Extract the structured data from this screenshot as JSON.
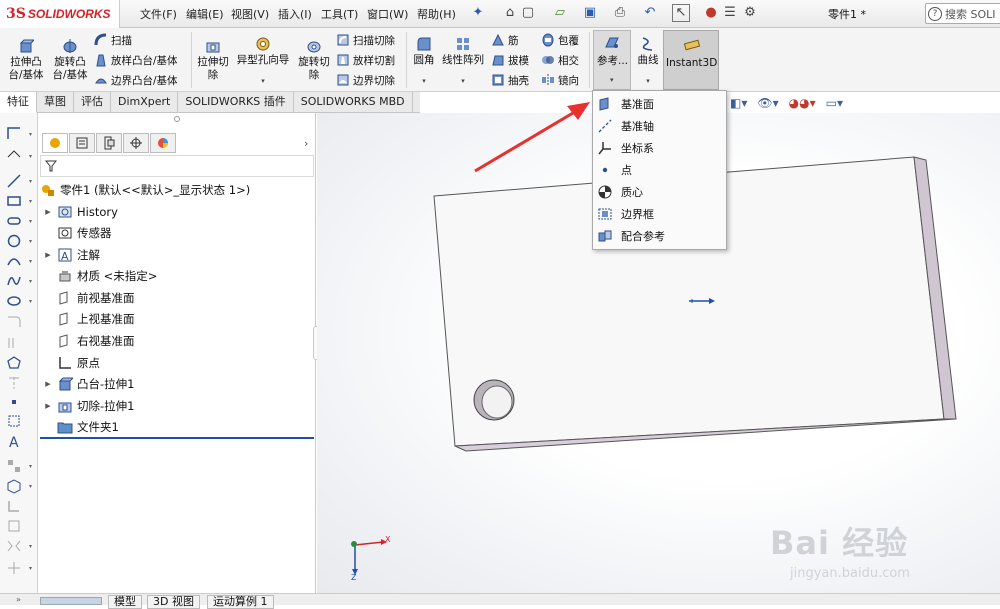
{
  "app": {
    "brand_ds": "3S",
    "brand_name": "SOLIDWORKS",
    "doc_title": "零件1 *"
  },
  "menu": [
    "文件(F)",
    "编辑(E)",
    "视图(V)",
    "插入(I)",
    "工具(T)",
    "窗口(W)",
    "帮助(H)"
  ],
  "search": {
    "label": "搜索 SOLI"
  },
  "ribbon": {
    "extrude_boss": "拉伸凸\n台/基体",
    "revolve_boss": "旋转凸\n台/基体",
    "sweep": "扫描",
    "loft_boss": "放样凸台/基体",
    "boundary_boss": "边界凸台/基体",
    "extrude_cut": "拉伸切\n除",
    "hole_wizard": "异型孔向导",
    "revolve_cut": "旋转切\n除",
    "swept_cut": "扫描切除",
    "lofted_cut": "放样切割",
    "boundary_cut": "边界切除",
    "fillet": "圆角",
    "linear_pattern": "线性阵列",
    "rib": "筋",
    "draft": "拔模",
    "shell": "抽壳",
    "wrap": "包覆",
    "intersect": "相交",
    "mirror": "镜向",
    "reference": "参考...",
    "curves": "曲线",
    "instant3d": "Instant3D"
  },
  "tabs": [
    "特征",
    "草图",
    "评估",
    "DimXpert",
    "SOLIDWORKS 插件",
    "SOLIDWORKS MBD"
  ],
  "tree": {
    "root": "零件1 (默认<<默认>_显示状态 1>)",
    "items": [
      {
        "label": "History",
        "expandable": true
      },
      {
        "label": "传感器",
        "expandable": false
      },
      {
        "label": "注解",
        "expandable": true
      },
      {
        "label": "材质 <未指定>",
        "expandable": false
      },
      {
        "label": "前视基准面",
        "expandable": false
      },
      {
        "label": "上视基准面",
        "expandable": false
      },
      {
        "label": "右视基准面",
        "expandable": false
      },
      {
        "label": "原点",
        "expandable": false
      },
      {
        "label": "凸台-拉伸1",
        "expandable": true
      },
      {
        "label": "切除-拉伸1",
        "expandable": true
      },
      {
        "label": "文件夹1",
        "expandable": false
      }
    ]
  },
  "reference_menu": [
    "基准面",
    "基准轴",
    "坐标系",
    "点",
    "质心",
    "边界框",
    "配合参考"
  ],
  "bottom_tabs": [
    "模型",
    "3D 视图",
    "运动算例 1"
  ],
  "triad": {
    "x": "X",
    "z": "Z"
  },
  "watermark": {
    "brand": "Bai 经验",
    "url": "jingyan.baidu.com"
  },
  "colors": {
    "accent_red": "#d2232a",
    "selection_blue": "#1f4fa8",
    "instant3d_bg": "#cfcfcf",
    "annotation_arrow": "#e8302e"
  }
}
